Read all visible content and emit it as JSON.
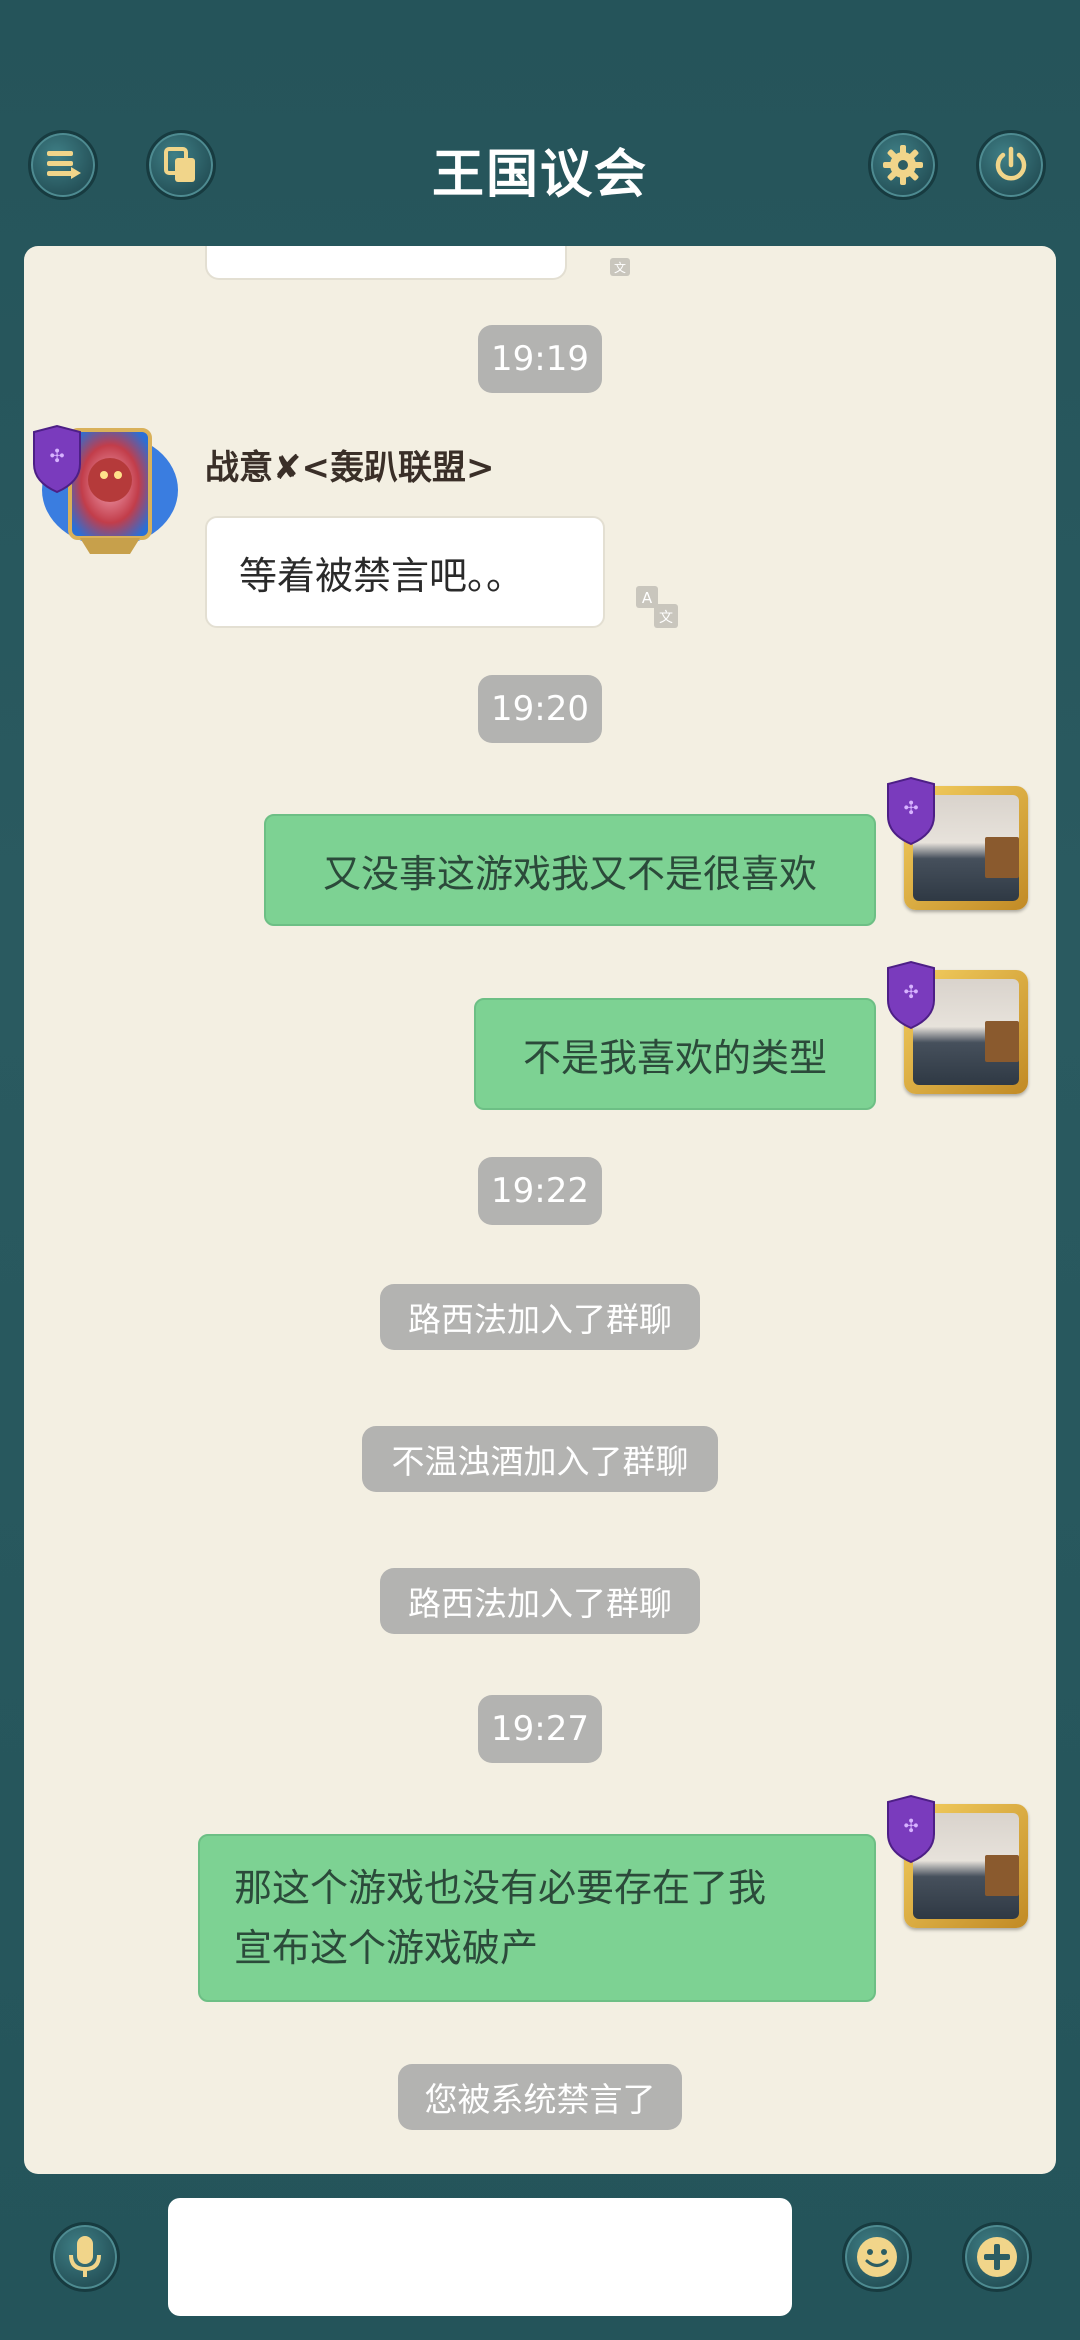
{
  "header": {
    "title": "王国议会",
    "left_icons": [
      "list-icon",
      "copy-icon"
    ],
    "right_icons": [
      "gear-icon",
      "power-icon"
    ]
  },
  "chat": {
    "times": [
      "19:19",
      "19:20",
      "19:22",
      "19:27"
    ],
    "incoming": {
      "sender": "战意✘<轰趴联盟>",
      "text": "等着被禁言吧。。"
    },
    "outgoing": [
      {
        "text": "又没事这游戏我又不是很喜欢"
      },
      {
        "text": "不是我喜欢的类型"
      },
      {
        "lines": [
          "那这个游戏也没有必要存在了我",
          "宣布这个游戏破产"
        ]
      }
    ],
    "system": [
      "路西法加入了群聊",
      "不温浊酒加入了群聊",
      "路西法加入了群聊",
      "您被系统禁言了"
    ]
  },
  "input": {
    "placeholder": "",
    "icons": [
      "microphone-icon",
      "emoji-icon",
      "plus-icon"
    ]
  },
  "colors": {
    "background": "#25545a",
    "panel": "#f3efe2",
    "outgoing_bubble": "#7dd293",
    "chip": "#b3b3b1"
  }
}
